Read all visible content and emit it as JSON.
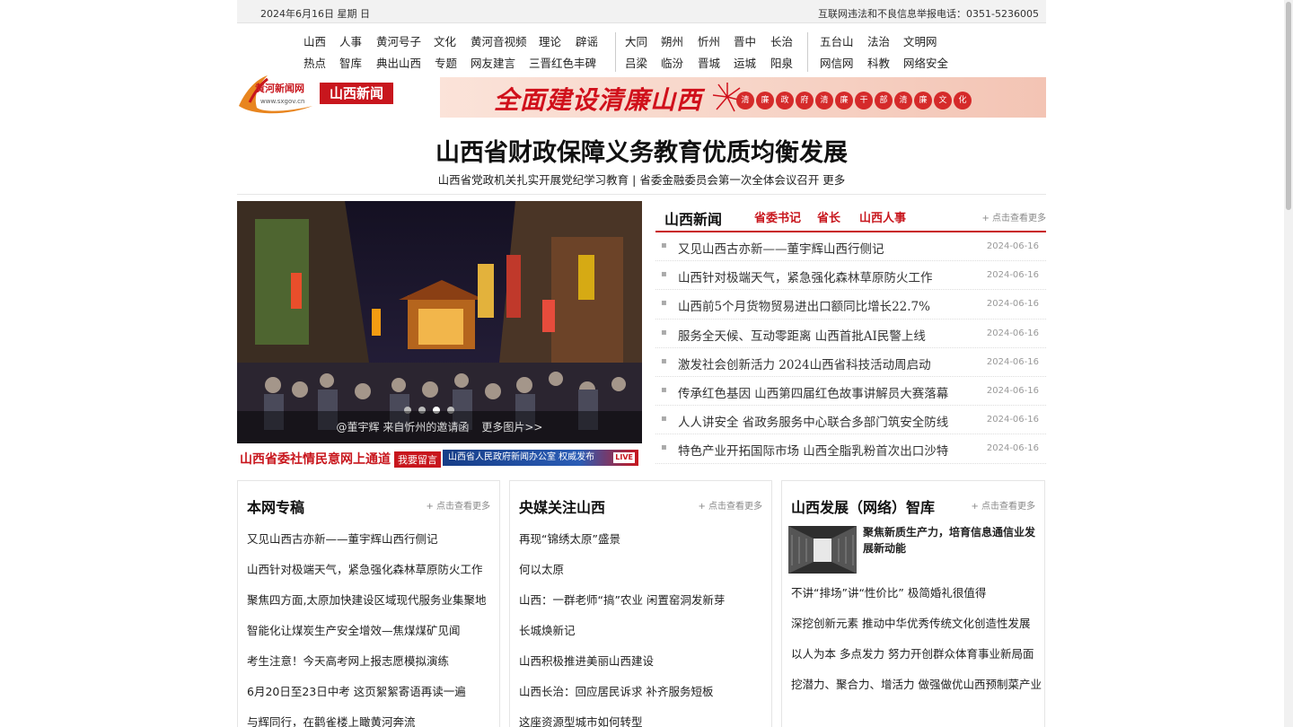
{
  "topbar": {
    "date": "2024年6月16日 星期 日",
    "hotline": "互联网违法和不良信息举报电话：0351-5236005"
  },
  "nav": {
    "group1_row1": [
      "山西",
      "人事",
      "黄河号子",
      "文化",
      "黄河音视频",
      "理论",
      "辟谣"
    ],
    "group1_row2": [
      "热点",
      "智库",
      "典出山西",
      "专题",
      "网友建言",
      "三晋红色丰碑"
    ],
    "group2_row1": [
      "大同",
      "朔州",
      "忻州",
      "晋中",
      "长治"
    ],
    "group2_row2": [
      "吕梁",
      "临汾",
      "晋城",
      "运城",
      "阳泉"
    ],
    "group3_row1": [
      "五台山",
      "法治",
      "文明网"
    ],
    "group3_row2": [
      "网信网",
      "科教",
      "网络安全"
    ]
  },
  "logo": {
    "name": "黄河新闻网",
    "url": "www.sxgov.cn",
    "badge": "山西新闻"
  },
  "banner": {
    "text": "全面建设清廉山西",
    "circles": [
      "清",
      "廉",
      "政",
      "府",
      "清",
      "廉",
      "干",
      "部",
      "清",
      "廉",
      "文",
      "化"
    ]
  },
  "headline": {
    "title": "山西省财政保障义务教育优质均衡发展",
    "sub": "山西省党政机关扎实开展党纪学习教育 | 省委金融委员会第一次全体会议召开 更多"
  },
  "photo": {
    "caption": "@董宇辉 来自忻州的邀请函",
    "more": "更多图片>>"
  },
  "promo": {
    "left": "山西省委社情民意网上通道",
    "left_btn": "我要留言",
    "right": "山西省人民政府新闻办公室 权威发布",
    "live": "LIVE"
  },
  "news": {
    "heading": "山西新闻",
    "tabs": [
      "省委书记",
      "省长",
      "山西人事"
    ],
    "more": "+ 点击查看更多",
    "items": [
      {
        "title": "又见山西古亦新——董宇辉山西行侧记",
        "date": "2024-06-16"
      },
      {
        "title": "山西针对极端天气，紧急强化森林草原防火工作",
        "date": "2024-06-16"
      },
      {
        "title": "山西前5个月货物贸易进出口额同比增长22.7%",
        "date": "2024-06-16"
      },
      {
        "title": "服务全天候、互动零距离 山西首批AI民警上线",
        "date": "2024-06-16"
      },
      {
        "title": "激发社会创新活力 2024山西省科技活动周启动",
        "date": "2024-06-16"
      },
      {
        "title": "传承红色基因 山西第四届红色故事讲解员大赛落幕",
        "date": "2024-06-16"
      },
      {
        "title": "人人讲安全 省政务服务中心联合多部门筑安全防线",
        "date": "2024-06-16"
      },
      {
        "title": "特色产业开拓国际市场 山西全脂乳粉首次出口沙特",
        "date": "2024-06-16"
      }
    ]
  },
  "col1": {
    "heading": "本网专稿",
    "more": "+ 点击查看更多",
    "items": [
      "又见山西古亦新——董宇辉山西行侧记",
      "山西针对极端天气，紧急强化森林草原防火工作",
      "聚焦四方面,太原加快建设区域现代服务业集聚地",
      "智能化让煤炭生产安全增效—焦煤煤矿见闻",
      "考生注意！今天高考网上报志愿模拟演练",
      "6月20日至23日中考 这页絮絮寄语再读一遍",
      "与辉同行，在鹳雀楼上瞰黄河奔流"
    ]
  },
  "col2": {
    "heading": "央媒关注山西",
    "more": "+ 点击查看更多",
    "items": [
      "再现“锦绣太原”盛景",
      "何以太原",
      "山西：一群老师“搞”农业 闲置窑洞发新芽",
      "长城焕新记",
      "山西积极推进美丽山西建设",
      "山西长治：回应居民诉求 补齐服务短板",
      "这座资源型城市如何转型"
    ]
  },
  "col3": {
    "heading": "山西发展（网络）智库",
    "more": "+ 点击查看更多",
    "feature": "聚焦新质生产力，培育信息通信业发展新动能",
    "items": [
      "不讲“排场”讲“性价比” 极简婚礼很值得",
      "深挖创新元素 推动中华优秀传统文化创造性发展",
      "以人为本 多点发力 努力开创群众体育事业新局面",
      "挖潜力、聚合力、增活力 做强做优山西预制菜产业"
    ]
  },
  "colors": {
    "brand_red": "#c8161d",
    "topbar_bg": "#f2f2f2"
  }
}
